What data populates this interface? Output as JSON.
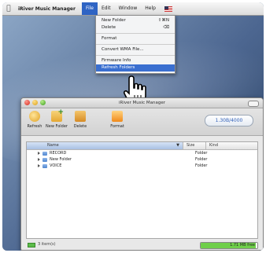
{
  "menubar": {
    "app_name": "iRiver Music Manager",
    "items": [
      "File",
      "Edit",
      "Window",
      "Help"
    ]
  },
  "file_menu": {
    "items": [
      {
        "label": "New Folder",
        "shortcut": "⇧⌘N",
        "disabled": false,
        "highlighted": false
      },
      {
        "label": "Delete",
        "shortcut": "⌫",
        "disabled": false,
        "highlighted": false
      },
      {
        "label": "Format",
        "shortcut": "",
        "disabled": false,
        "highlighted": false
      },
      {
        "label": "Convert WMA File...",
        "shortcut": "",
        "disabled": false,
        "highlighted": false
      },
      {
        "label": "Firmware Info",
        "shortcut": "",
        "disabled": false,
        "highlighted": false
      },
      {
        "label": "Refresh Folders",
        "shortcut": "",
        "disabled": false,
        "highlighted": true
      }
    ]
  },
  "window": {
    "title": "iRiver Music Manager",
    "toolbar": {
      "refresh": "Refresh",
      "new_folder": "New Folder",
      "delete": "Delete",
      "format": "Format"
    },
    "capacity": "1.30B/4000",
    "columns": {
      "name": "Name",
      "size": "Size",
      "kind": "Kind"
    },
    "rows": [
      {
        "name": "RECORD",
        "size": "",
        "kind": "Folder"
      },
      {
        "name": "New Folder",
        "size": "",
        "kind": "Folder"
      },
      {
        "name": "VOICE",
        "size": "",
        "kind": "Folder"
      }
    ],
    "status": {
      "items": "3 item(s)",
      "free": "1.71 MB free",
      "used_fraction": 0.97
    }
  },
  "colors": {
    "highlight": "#3a6fd0",
    "menubar_active": "#2f64c4"
  }
}
